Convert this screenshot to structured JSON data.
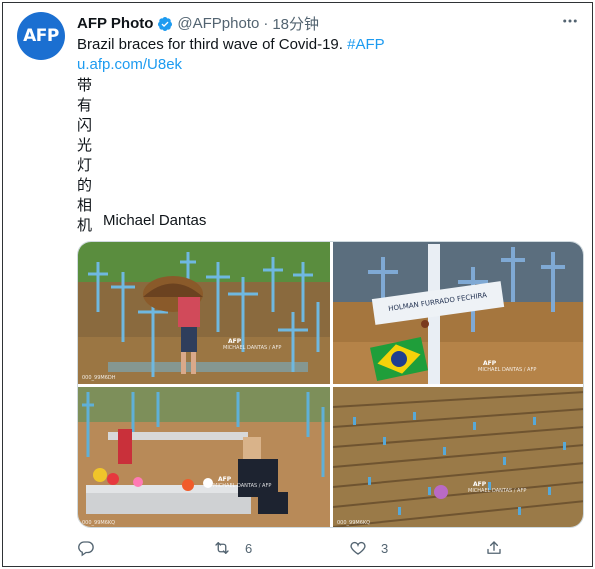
{
  "tweet": {
    "author_name": "AFP Photo",
    "avatar_text": "AFP",
    "handle": "@AFPphoto",
    "separator": "·",
    "time": "18分钟",
    "text": "Brazil braces for third wave of Covid-19.",
    "hashtag": "#AFP",
    "link": "u.afp.com/U8ek",
    "vertical_chars": [
      "带",
      "有",
      "闪",
      "光",
      "灯",
      "的",
      "相",
      "机"
    ],
    "credit": "Michael Dantas"
  },
  "photos": [
    {
      "watermark_brand": "AFP",
      "watermark_credit": "MICHAEL DANTAS / AFP",
      "id": "000_99M6DH"
    },
    {
      "watermark_brand": "AFP",
      "watermark_credit": "MICHAEL DANTAS / AFP"
    },
    {
      "watermark_brand": "AFP",
      "watermark_credit": "MICHAEL DANTAS / AFP",
      "id": "000_99M6KQ"
    },
    {
      "watermark_brand": "AFP",
      "watermark_credit": "MICHAEL DANTAS / AFP",
      "id": "000_99M6KQ"
    }
  ],
  "actions": {
    "reply_count": "",
    "retweet_count": "6",
    "like_count": "3"
  },
  "icons": {
    "verified": "verified-badge-icon",
    "more": "more-horizontal-icon",
    "reply": "reply-icon",
    "retweet": "retweet-icon",
    "like": "heart-icon",
    "share": "share-icon"
  },
  "colors": {
    "accent": "#1d9bf0",
    "secondary_text": "#536471",
    "avatar_bg": "#1b6fd1"
  }
}
